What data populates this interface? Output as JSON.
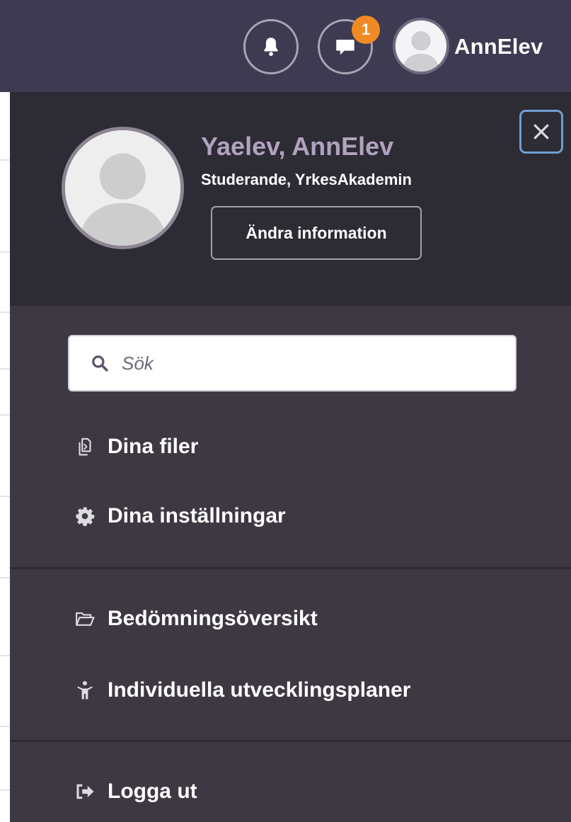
{
  "header": {
    "notifications_icon": "bell-icon",
    "messages_icon": "chat-icon",
    "messages_badge": "1",
    "username": "AnnElev"
  },
  "profile": {
    "name": "Yaelev, AnnElev",
    "role": "Studerande, YrkesAkademin",
    "edit_label": "Ändra information"
  },
  "search": {
    "placeholder": "Sök"
  },
  "menu": {
    "items": [
      {
        "label": "Dina filer",
        "icon": "files-icon"
      },
      {
        "label": "Dina inställningar",
        "icon": "gear-icon"
      },
      {
        "label": "Bedömningsöversikt",
        "icon": "folder-open-icon"
      },
      {
        "label": "Individuella utvecklingsplaner",
        "icon": "person-icon"
      },
      {
        "label": "Logga ut",
        "icon": "logout-icon"
      }
    ]
  },
  "colors": {
    "topbar": "#3d3a52",
    "drawer": "#3e3842",
    "profile_bg": "#2d2b33",
    "accent_name": "#b1a3c0",
    "badge": "#f08a24",
    "close_border": "#6f9ed4"
  }
}
